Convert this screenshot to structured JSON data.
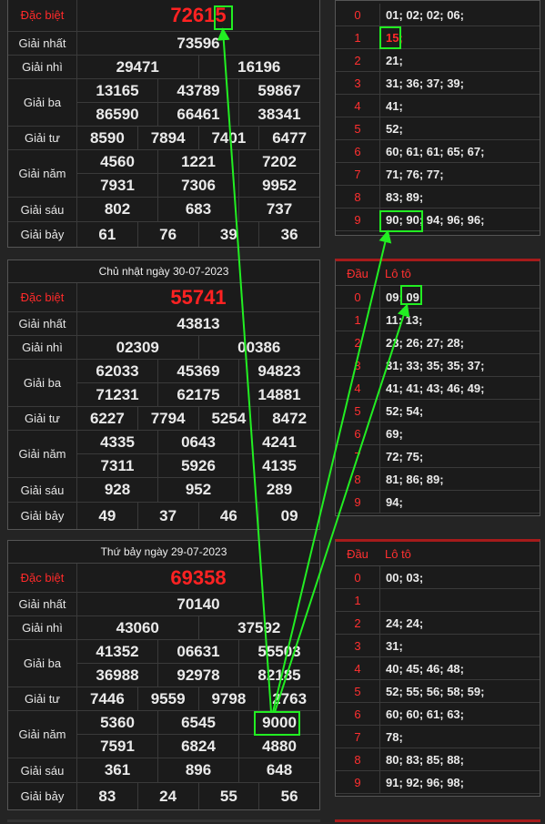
{
  "row_labels": {
    "special": "Đặc biệt",
    "first": "Giải nhất",
    "second": "Giải nhì",
    "third": "Giải ba",
    "fourth": "Giải tư",
    "fifth": "Giải năm",
    "sixth": "Giải sáu",
    "seventh": "Giải bảy"
  },
  "loto_header": {
    "dau": "Đầu",
    "loto": "Lô tô"
  },
  "accent_color": "#ff2a2a",
  "highlight_color": "#22ee22",
  "results": [
    {
      "date": "",
      "special": "72615",
      "first": "73596",
      "second": [
        "29471",
        "16196"
      ],
      "third": [
        [
          "13165",
          "43789",
          "59867"
        ],
        [
          "86590",
          "66461",
          "38341"
        ]
      ],
      "fourth": [
        "8590",
        "7894",
        "7401",
        "6477"
      ],
      "fifth": [
        [
          "4560",
          "1221",
          "7202"
        ],
        [
          "7931",
          "7306",
          "9952"
        ]
      ],
      "sixth": [
        "802",
        "683",
        "737"
      ],
      "seventh": [
        "61",
        "76",
        "39",
        "36"
      ]
    },
    {
      "date": "Chủ nhật ngày 30-07-2023",
      "special": "55741",
      "first": "43813",
      "second": [
        "02309",
        "00386"
      ],
      "third": [
        [
          "62033",
          "45369",
          "94823"
        ],
        [
          "71231",
          "62175",
          "14881"
        ]
      ],
      "fourth": [
        "6227",
        "7794",
        "5254",
        "8472"
      ],
      "fifth": [
        [
          "4335",
          "0643",
          "4241"
        ],
        [
          "7311",
          "5926",
          "4135"
        ]
      ],
      "sixth": [
        "928",
        "952",
        "289"
      ],
      "seventh": [
        "49",
        "37",
        "46",
        "09"
      ]
    },
    {
      "date": "Thứ bảy ngày 29-07-2023",
      "special": "69358",
      "first": "70140",
      "second": [
        "43060",
        "37592"
      ],
      "third": [
        [
          "41352",
          "06631",
          "55503"
        ],
        [
          "36988",
          "92978",
          "82185"
        ]
      ],
      "fourth": [
        "7446",
        "9559",
        "9798",
        "2763"
      ],
      "fifth": [
        [
          "5360",
          "6545",
          "9000"
        ],
        [
          "7591",
          "6824",
          "4880"
        ]
      ],
      "sixth": [
        "361",
        "896",
        "648"
      ],
      "seventh": [
        "83",
        "24",
        "55",
        "56"
      ]
    }
  ],
  "loto": [
    [
      {
        "dau": "0",
        "loto": "01; 02; 02; 06;"
      },
      {
        "dau": "1",
        "loto": "15;"
      },
      {
        "dau": "2",
        "loto": "21;"
      },
      {
        "dau": "3",
        "loto": "31; 36; 37; 39;"
      },
      {
        "dau": "4",
        "loto": "41;"
      },
      {
        "dau": "5",
        "loto": "52;"
      },
      {
        "dau": "6",
        "loto": "60; 61; 61; 65; 67;"
      },
      {
        "dau": "7",
        "loto": "71; 76; 77;"
      },
      {
        "dau": "8",
        "loto": "83; 89;"
      },
      {
        "dau": "9",
        "loto": "90; 90; 94; 96; 96;"
      }
    ],
    [
      {
        "dau": "0",
        "loto": "09; 09;"
      },
      {
        "dau": "1",
        "loto": "11; 13;"
      },
      {
        "dau": "2",
        "loto": "23; 26; 27; 28;"
      },
      {
        "dau": "3",
        "loto": "31; 33; 35; 35; 37;"
      },
      {
        "dau": "4",
        "loto": "41; 41; 43; 46; 49;"
      },
      {
        "dau": "5",
        "loto": "52; 54;"
      },
      {
        "dau": "6",
        "loto": "69;"
      },
      {
        "dau": "7",
        "loto": "72; 75;"
      },
      {
        "dau": "8",
        "loto": "81; 86; 89;"
      },
      {
        "dau": "9",
        "loto": "94;"
      }
    ],
    [
      {
        "dau": "0",
        "loto": "00; 03;"
      },
      {
        "dau": "1",
        "loto": ""
      },
      {
        "dau": "2",
        "loto": "24; 24;"
      },
      {
        "dau": "3",
        "loto": "31;"
      },
      {
        "dau": "4",
        "loto": "40; 45; 46; 48;"
      },
      {
        "dau": "5",
        "loto": "52; 55; 56; 58; 59;"
      },
      {
        "dau": "6",
        "loto": "60; 60; 61; 63;"
      },
      {
        "dau": "7",
        "loto": "78;"
      },
      {
        "dau": "8",
        "loto": "80; 83; 85; 88;"
      },
      {
        "dau": "9",
        "loto": "91; 92; 96; 98;"
      }
    ]
  ]
}
